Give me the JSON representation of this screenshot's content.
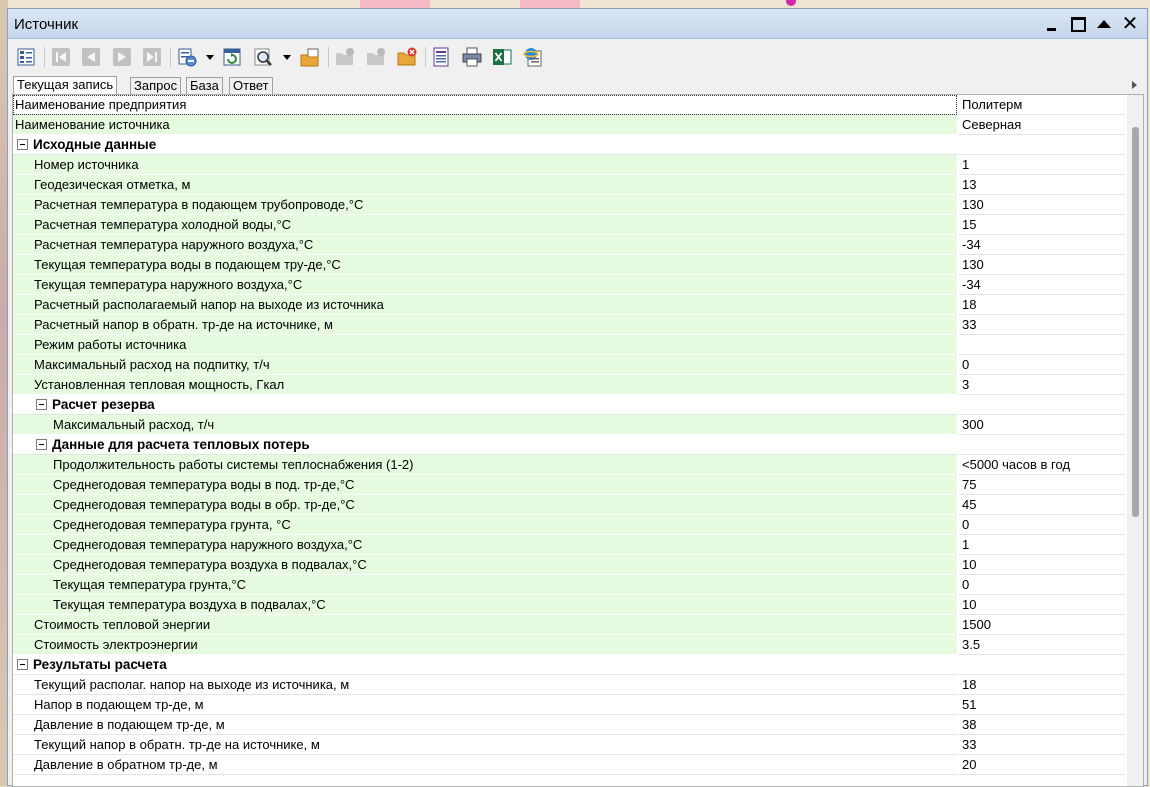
{
  "window": {
    "title": "Источник"
  },
  "tabs": [
    {
      "label": "Текущая запись",
      "active": true
    },
    {
      "label": "Запрос"
    },
    {
      "label": "База"
    },
    {
      "label": "Ответ"
    }
  ],
  "grid": {
    "rows": [
      {
        "label": "Наименование предприятия",
        "value": "Политерм"
      },
      {
        "label": "Наименование источника",
        "value": "Северная"
      },
      {
        "label": "Исходные данные",
        "group": true
      },
      {
        "label": "Номер источника",
        "value": "1"
      },
      {
        "label": "Геодезическая отметка, м",
        "value": "13"
      },
      {
        "label": "Расчетная температура в подающем трубопроводе,°C",
        "value": "130"
      },
      {
        "label": "Расчетная температура холодной воды,°C",
        "value": "15"
      },
      {
        "label": "Расчетная температура наружного воздуха,°C",
        "value": "-34"
      },
      {
        "label": "Текущая температура воды в подающем тру-де,°C",
        "value": "130"
      },
      {
        "label": "Текущая температура  наружного воздуха,°C",
        "value": "-34"
      },
      {
        "label": "Расчетный располагаемый напор на выходе из источника",
        "value": "18"
      },
      {
        "label": "Расчетный напор в обратн. тр-де на источнике, м",
        "value": "33"
      },
      {
        "label": "Режим работы источника",
        "value": ""
      },
      {
        "label": "Максимальный расход на подпитку, т/ч",
        "value": "0"
      },
      {
        "label": "Установленная тепловая мощность, Гкал",
        "value": "3"
      },
      {
        "label": "Расчет резерва",
        "group": true
      },
      {
        "label": "Максимальный расход, т/ч",
        "value": "300"
      },
      {
        "label": "Данные для расчета тепловых потерь",
        "group": true
      },
      {
        "label": "Продолжительность работы системы теплоснабжения (1-2)",
        "value": "<5000 часов в год"
      },
      {
        "label": "Среднегодовая температура воды в под. тр-де,°C",
        "value": "75"
      },
      {
        "label": "Среднегодовая температура воды в обр. тр-де,°C",
        "value": "45"
      },
      {
        "label": "Среднегодовая температура грунта, °C",
        "value": "0"
      },
      {
        "label": "Среднегодовая температура наружного воздуха,°C",
        "value": "1"
      },
      {
        "label": "Среднегодовая температура воздуха в подвалах,°C",
        "value": "10"
      },
      {
        "label": "Текущая температура грунта,°C",
        "value": "0"
      },
      {
        "label": "Текущая температура воздуха в подвалах,°C",
        "value": "10"
      },
      {
        "label": "Стоимость тепловой энергии",
        "value": "1500"
      },
      {
        "label": "Стоимость электроэнергии",
        "value": "3.5"
      },
      {
        "label": "Результаты расчета",
        "group": true
      },
      {
        "label": "Текущий располаг. напор на выходе из источника, м",
        "value": "18"
      },
      {
        "label": "Напор в подающем тр-де, м",
        "value": "51"
      },
      {
        "label": "Давление в подающем тр-де, м",
        "value": "38"
      },
      {
        "label": "Текущий напор в обратн. тр-де на источнике, м",
        "value": "33"
      },
      {
        "label": "Давление в обратном тр-де, м",
        "value": "20"
      }
    ]
  }
}
